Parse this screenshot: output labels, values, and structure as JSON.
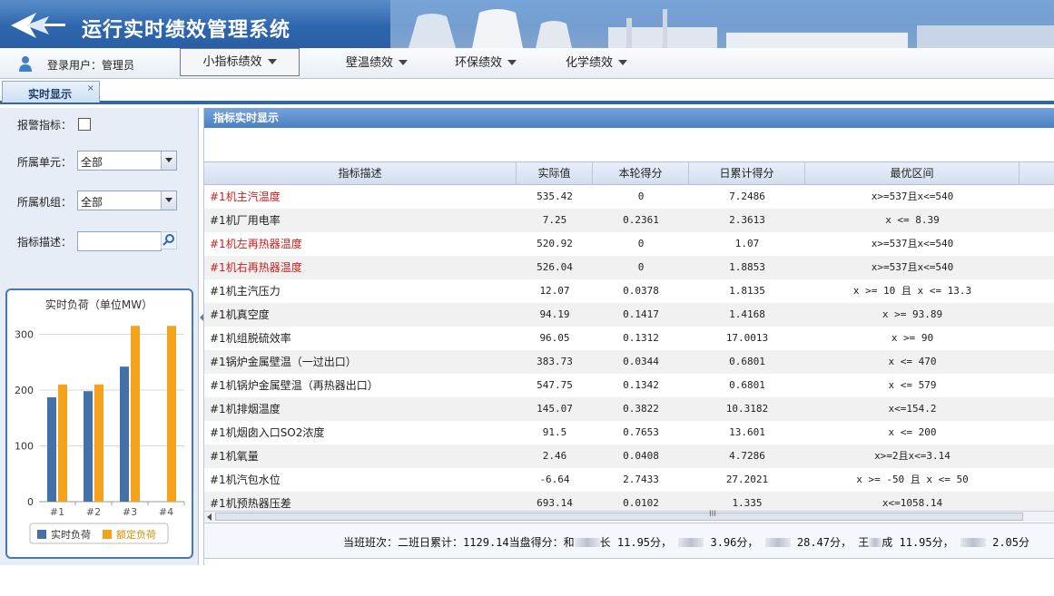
{
  "app": {
    "title": "运行实时绩效管理系统"
  },
  "user": {
    "label": "登录用户：管理员"
  },
  "menu": [
    {
      "label": "小指标绩效",
      "active": true
    },
    {
      "label": "壁温绩效",
      "active": false
    },
    {
      "label": "环保绩效",
      "active": false
    },
    {
      "label": "化学绩效",
      "active": false
    }
  ],
  "tabs": [
    {
      "label": "实时显示",
      "close": "×"
    }
  ],
  "filters": {
    "alarm_label": "报警指标：",
    "unit_label": "所属单元：",
    "unit_value": "全部",
    "group_label": "所属机组：",
    "group_value": "全部",
    "desc_label": "指标描述：",
    "desc_value": ""
  },
  "chart_data": {
    "type": "bar",
    "title": "实时负荷（单位MW）",
    "categories": [
      "#1",
      "#2",
      "#3",
      "#4"
    ],
    "series": [
      {
        "name": "实时负荷",
        "values": [
          187,
          198,
          242,
          0
        ],
        "color": "#4472a8"
      },
      {
        "name": "额定负荷",
        "values": [
          210,
          210,
          315,
          315
        ],
        "color": "#f5a21c"
      }
    ],
    "ylim": [
      0,
      330
    ],
    "yticks": [
      "0",
      "100",
      "200",
      "300"
    ],
    "grid": true,
    "legend": "bottom"
  },
  "panel": {
    "title": "指标实时显示"
  },
  "table": {
    "columns": [
      "指标描述",
      "实际值",
      "本轮得分",
      "日累计得分",
      "最优区间"
    ],
    "rows": [
      {
        "desc": "#1机主汽温度",
        "actual": "535.42",
        "round": "0",
        "daily": "7.2486",
        "range": "x>=537且x<=540",
        "alarm": true
      },
      {
        "desc": "#1机厂用电率",
        "actual": "7.25",
        "round": "0.2361",
        "daily": "2.3613",
        "range": "x <= 8.39",
        "alarm": false
      },
      {
        "desc": "#1机左再热器温度",
        "actual": "520.92",
        "round": "0",
        "daily": "1.07",
        "range": "x>=537且x<=540",
        "alarm": true
      },
      {
        "desc": "#1机右再热器温度",
        "actual": "526.04",
        "round": "0",
        "daily": "1.8853",
        "range": "x>=537且x<=540",
        "alarm": true
      },
      {
        "desc": "#1机主汽压力",
        "actual": "12.07",
        "round": "0.0378",
        "daily": "1.8135",
        "range": "x >= 10 且 x <= 13.3",
        "alarm": false
      },
      {
        "desc": "#1机真空度",
        "actual": "94.19",
        "round": "0.1417",
        "daily": "1.4168",
        "range": "x >= 93.89",
        "alarm": false
      },
      {
        "desc": "#1机组脱硫效率",
        "actual": "96.05",
        "round": "0.1312",
        "daily": "17.0013",
        "range": "x >= 90",
        "alarm": false
      },
      {
        "desc": "#1锅炉金属壁温（一过出口）",
        "actual": "383.73",
        "round": "0.0344",
        "daily": "0.6801",
        "range": "x <= 470",
        "alarm": false
      },
      {
        "desc": "#1机锅炉金属壁温（再热器出口）",
        "actual": "547.75",
        "round": "0.1342",
        "daily": "0.6801",
        "range": "x <= 579",
        "alarm": false
      },
      {
        "desc": "#1机排烟温度",
        "actual": "145.07",
        "round": "0.3822",
        "daily": "10.3182",
        "range": "x<=154.2",
        "alarm": false
      },
      {
        "desc": "#1机烟囱入口SO2浓度",
        "actual": "91.5",
        "round": "0.7653",
        "daily": "13.601",
        "range": "x <= 200",
        "alarm": false
      },
      {
        "desc": "#1机氧量",
        "actual": "2.46",
        "round": "0.0408",
        "daily": "4.7286",
        "range": "x>=2且x<=3.14",
        "alarm": false
      },
      {
        "desc": "#1机汽包水位",
        "actual": "-6.64",
        "round": "2.7433",
        "daily": "27.2021",
        "range": "x >= -50 且 x <= 50",
        "alarm": false
      },
      {
        "desc": "#1机预热器压差",
        "actual": "693.14",
        "round": "0.0102",
        "daily": "1.335",
        "range": "x<=1058.14",
        "alarm": false
      }
    ]
  },
  "scroll": {
    "grip": "III"
  },
  "footer": {
    "prefix": "当班班次：二班日累计：",
    "daily_total": "1129.14",
    "mid_label": "当盘得分：",
    "score_1_prefix": "和",
    "score_1_suffix": "长",
    "score_1": "11.95分，",
    "score_2": "3.96分，",
    "score_3": "28.47分，",
    "score_4_prefix": "王",
    "score_4_suffix": "成",
    "score_4": "11.95分，",
    "score_5": "2.05分"
  }
}
